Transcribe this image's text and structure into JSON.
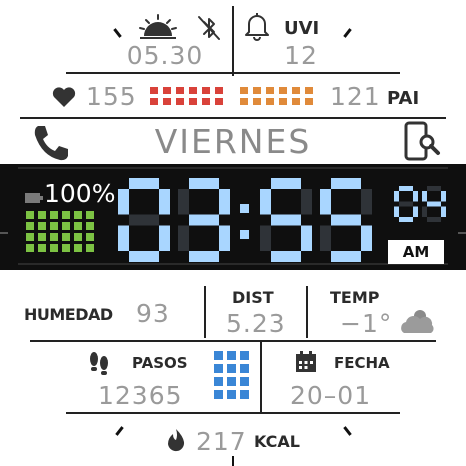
{
  "top": {
    "sunrise_time": "05.30",
    "uvi_label": "UVI",
    "uvi_value": "12"
  },
  "heart": {
    "bpm": "155",
    "pai_value": "121",
    "pai_label": "PAI"
  },
  "day": "VIERNES",
  "battery": {
    "percent": "100%"
  },
  "time": {
    "hours": "03",
    "minutes": "55",
    "seconds": "04",
    "ampm": "AM"
  },
  "stats": {
    "humidity_label": "HUMEDAD",
    "humidity_value": "93",
    "dist_label": "DIST",
    "dist_value": "5.23",
    "temp_label": "TEMP",
    "temp_value": "−1°"
  },
  "steps": {
    "label": "PASOS",
    "value": "12365"
  },
  "date": {
    "label": "FECHA",
    "value": "20–01"
  },
  "calories": {
    "value": "217",
    "label": "KCAL"
  },
  "icons": {
    "sunrise": "sunrise-icon",
    "bluetooth_off": "bluetooth-off-icon",
    "alarm": "bell-icon",
    "heart": "heart-icon",
    "phone": "phone-icon",
    "phone_search": "phone-search-icon",
    "battery": "battery-icon",
    "cloud": "cloud-icon",
    "footsteps": "footsteps-icon",
    "calendar": "calendar-icon",
    "flame": "flame-icon"
  },
  "colors": {
    "digit_on": "#a9d6ff",
    "digit_off": "#2f3338",
    "lcd_bg": "#0f0f0f",
    "heart_bar_red": "#d9423a",
    "heart_bar_orange": "#e08a3a",
    "battery_green": "#7cc243",
    "steps_blue": "#3a86d6"
  }
}
